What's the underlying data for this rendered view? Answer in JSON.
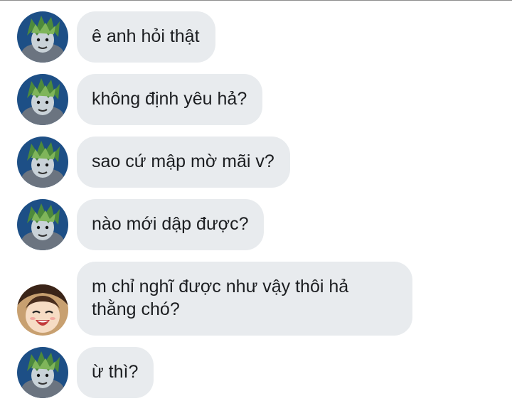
{
  "messages": [
    {
      "text": "ê anh hỏi thật",
      "avatar": "green-hair-avatar-icon"
    },
    {
      "text": "không định yêu hả?",
      "avatar": "green-hair-avatar-icon"
    },
    {
      "text": "sao cứ mập mờ mãi v?",
      "avatar": "green-hair-avatar-icon"
    },
    {
      "text": "nào mới dập được?",
      "avatar": "green-hair-avatar-icon"
    },
    {
      "text": "m chỉ nghĩ được như vậy thôi hả\nthằng chó?",
      "avatar": "laughing-girl-avatar-icon"
    },
    {
      "text": "ừ thì?",
      "avatar": "green-hair-avatar-icon"
    }
  ],
  "colors": {
    "bubble_bg": "#e8ebee",
    "text": "#1c1e21",
    "avatar_a_bg": "#1d4f86",
    "avatar_b_bg": "#c8a070"
  }
}
